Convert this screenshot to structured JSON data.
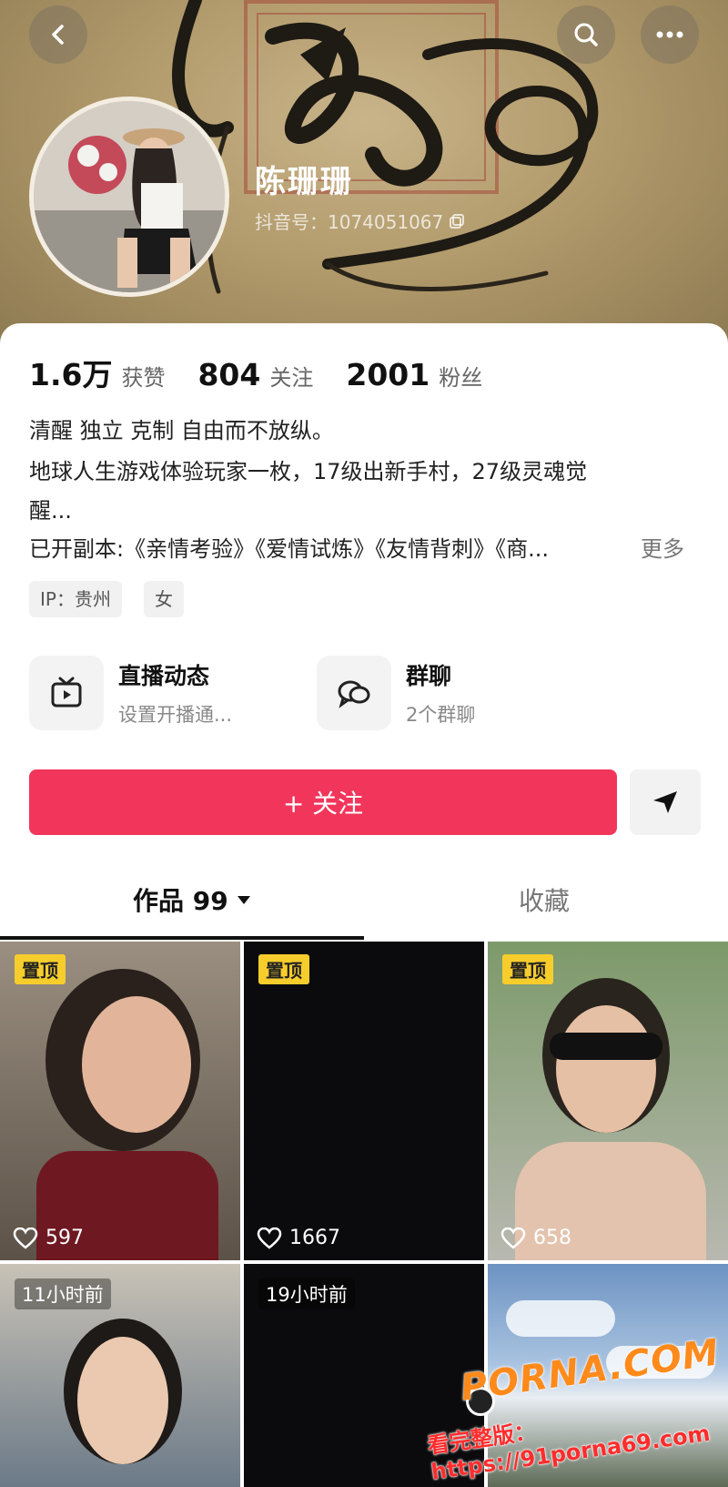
{
  "header": {
    "back_icon": "chevron-left-icon",
    "search_icon": "search-icon",
    "more_icon": "more-icon",
    "name": "陈珊珊",
    "douyin_id": "抖音号：1074051067",
    "copy_icon": "copy-icon"
  },
  "stats": [
    {
      "num": "1.6万",
      "label": "获赞"
    },
    {
      "num": "804",
      "label": "关注"
    },
    {
      "num": "2001",
      "label": "粉丝"
    }
  ],
  "bio": {
    "line1": "清醒 独立 克制 自由而不放纵。",
    "line2": "地球人生游戏体验玩家一枚，17级出新手村，27级灵魂觉",
    "line3": "醒...",
    "line4": "已开副本:《亲情考验》《爱情试炼》《友情背刺》《商...",
    "more": "更多"
  },
  "tags": [
    "IP：贵州",
    "女"
  ],
  "features": [
    {
      "title": "直播动态",
      "subtitle": "设置开播通...",
      "icon": "tv-icon"
    },
    {
      "title": "群聊",
      "subtitle": "2个群聊",
      "icon": "chat-bubbles-icon"
    }
  ],
  "follow_button": "+ 关注",
  "share_icon": "send-icon",
  "tabs": [
    {
      "label": "作品 99"
    },
    {
      "label": "收藏"
    }
  ],
  "videos": [
    {
      "badge": "置顶",
      "likes": "597"
    },
    {
      "badge": "置顶",
      "likes": "1667"
    },
    {
      "badge": "置顶",
      "likes": "658"
    },
    {
      "badge": "11小时前"
    },
    {
      "badge": "19小时前"
    },
    {
      "badge": ""
    }
  ],
  "watermark": {
    "site": "PORNA.COM",
    "url_text": "看完整版：https://91porna69.com"
  }
}
